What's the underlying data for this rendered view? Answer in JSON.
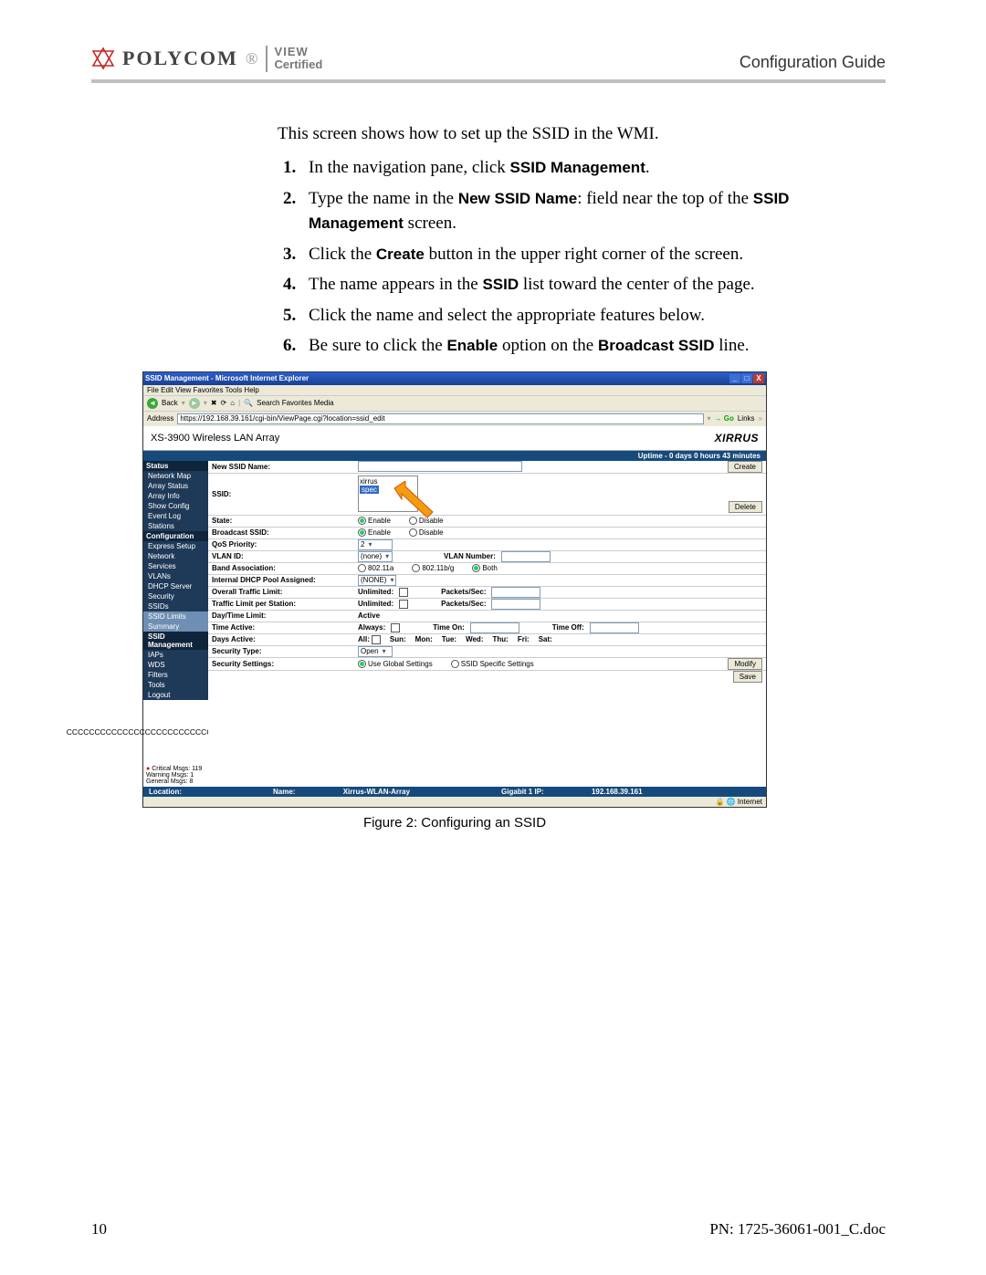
{
  "header": {
    "brand": "POLYCOM",
    "view": "VIEW",
    "certified": "Certified",
    "guide": "Configuration Guide"
  },
  "intro": "This screen shows how to set up the SSID in the WMI.",
  "steps": [
    {
      "num": "1.",
      "pre": "In the navigation pane, click ",
      "b1": "SSID Management",
      "post": "."
    },
    {
      "num": "2.",
      "pre": "Type the name in the ",
      "b1": "New SSID Name",
      "mid": ": field near the top of the ",
      "b2": "SSID Management",
      "post": " screen."
    },
    {
      "num": "3.",
      "pre": "Click the ",
      "b1": "Create",
      "post": " button in the upper right corner of the screen."
    },
    {
      "num": "4.",
      "pre": "The name appears in the ",
      "b1": "SSID",
      "post": " list toward the center of the page."
    },
    {
      "num": "5.",
      "pre": "Click the name and select the appropriate features below.",
      "b1": "",
      "post": ""
    },
    {
      "num": "6.",
      "pre": "Be sure to click the ",
      "b1": "Enable",
      "mid": " option on the ",
      "b2": "Broadcast SSID",
      "post": " line."
    }
  ],
  "figure_caption": "Figure 2: Configuring an SSID",
  "footer": {
    "page": "10",
    "pn": "PN: 1725-36061-001_C.doc"
  },
  "ie": {
    "title": "SSID Management - Microsoft Internet Explorer",
    "menu": "File  Edit  View  Favorites  Tools  Help",
    "back": "Back",
    "toolbar_items": "Search   Favorites   Media",
    "address_label": "Address",
    "address": "https://192.168.39.161/cgi-bin/ViewPage.cgi?location=ssid_edit",
    "go": "Go",
    "links": "Links",
    "status_internet": "Internet"
  },
  "wmi": {
    "array_title": "XS-3900 Wireless LAN Array",
    "brand": "XIRRUS",
    "uptime": "Uptime - 0 days 0 hours 43 minutes",
    "sidebar": {
      "status": "Status",
      "items1": [
        "Network Map",
        "Array Status",
        "Array Info",
        "Show Config",
        "Event Log",
        "Stations"
      ],
      "config": "Configuration",
      "items2": [
        "Express Setup",
        "Network",
        "Services",
        "VLANs",
        "DHCP Server",
        "Security",
        "SSIDs",
        "SSID Limits",
        "Summary",
        "SSID Management",
        "IAPs",
        "WDS",
        "Filters",
        "Tools",
        "Logout"
      ]
    },
    "msgs": {
      "critical_l": "Critical Msgs:",
      "critical_v": "119",
      "warning_l": "Warning Msgs:",
      "warning_v": "1",
      "general_l": "General Msgs:",
      "general_v": "8"
    },
    "rows": {
      "new_ssid": "New SSID Name:",
      "create_btn": "Create",
      "ssid_label": "SSID:",
      "ssid_items": [
        "xirrus",
        "spec"
      ],
      "delete_btn": "Delete",
      "state": "State:",
      "enable": "Enable",
      "disable": "Disable",
      "broadcast": "Broadcast SSID:",
      "qos": "QoS Priority:",
      "qos_val": "2",
      "vlan_id": "VLAN ID:",
      "vlan_val": "(none)",
      "vlan_num": "VLAN Number:",
      "band": "Band Association:",
      "b802a": "802.11a",
      "b802bg": "802.11b/g",
      "both": "Both",
      "dhcp": "Internal DHCP Pool Assigned:",
      "dhcp_val": "(NONE)",
      "ovtraf": "Overall Traffic Limit:",
      "unlimited": "Unlimited:",
      "pkts": "Packets/Sec:",
      "pstraf": "Traffic Limit per Station:",
      "daytime": "Day/Time Limit:",
      "active": "Active",
      "timeact": "Time Active:",
      "always": "Always:",
      "timeon": "Time On:",
      "timeoff": "Time Off:",
      "daysact": "Days Active:",
      "all": "All:",
      "sun": "Sun:",
      "mon": "Mon:",
      "tue": "Tue:",
      "wed": "Wed:",
      "thu": "Thu:",
      "fri": "Fri:",
      "sat": "Sat:",
      "sectype": "Security Type:",
      "open": "Open",
      "secset": "Security Settings:",
      "useglobal": "Use Global Settings",
      "ssidspec": "SSID Specific Settings",
      "modify": "Modify",
      "save": "Save"
    },
    "bottom": {
      "location": "Location:",
      "name_l": "Name:",
      "name_v": "Xirrus-WLAN-Array",
      "gig_l": "Gigabit 1 IP:",
      "gig_v": "192.168.39.161"
    }
  }
}
